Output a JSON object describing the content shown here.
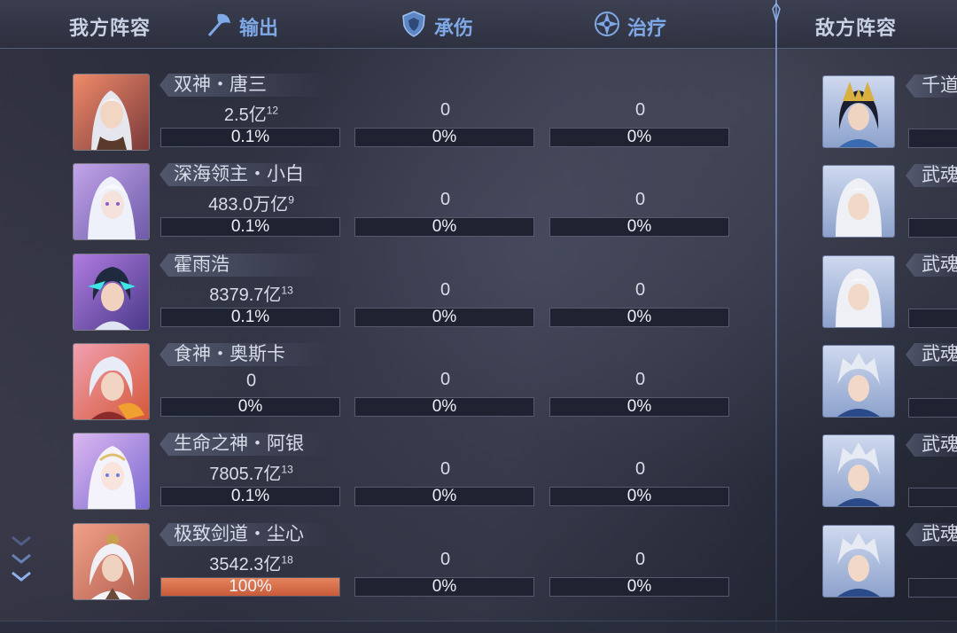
{
  "header": {
    "our_team": "我方阵容",
    "enemy_team": "敌方阵容",
    "tabs": [
      {
        "label": "输出",
        "icon": "axe-icon"
      },
      {
        "label": "承伤",
        "icon": "shield-icon"
      },
      {
        "label": "治疗",
        "icon": "heal-cross-icon"
      }
    ]
  },
  "colors": {
    "accent": "#7ea9e6",
    "output_bar_full": "#d86a46",
    "bar_bg": "#1f2230"
  },
  "our_rows": [
    {
      "name": "双神・唐三",
      "output": "2.5亿",
      "output_exp": "12",
      "output_pct": "0.1%",
      "output_fill": 0.001,
      "damage_taken": "0",
      "taken_pct": "0%",
      "healing": "0",
      "heal_pct": "0%"
    },
    {
      "name": "深海领主・小白",
      "output": "483.0万亿",
      "output_exp": "9",
      "output_pct": "0.1%",
      "output_fill": 0.001,
      "damage_taken": "0",
      "taken_pct": "0%",
      "healing": "0",
      "heal_pct": "0%"
    },
    {
      "name": "霍雨浩",
      "output": "8379.7亿",
      "output_exp": "13",
      "output_pct": "0.1%",
      "output_fill": 0.001,
      "damage_taken": "0",
      "taken_pct": "0%",
      "healing": "0",
      "heal_pct": "0%"
    },
    {
      "name": "食神・奥斯卡",
      "output": "0",
      "output_exp": "",
      "output_pct": "0%",
      "output_fill": 0,
      "damage_taken": "0",
      "taken_pct": "0%",
      "healing": "0",
      "heal_pct": "0%"
    },
    {
      "name": "生命之神・阿银",
      "output": "7805.7亿",
      "output_exp": "13",
      "output_pct": "0.1%",
      "output_fill": 0.001,
      "damage_taken": "0",
      "taken_pct": "0%",
      "healing": "0",
      "heal_pct": "0%"
    },
    {
      "name": "极致剑道・尘心",
      "output": "3542.3亿",
      "output_exp": "18",
      "output_pct": "100%",
      "output_fill": 1.0,
      "damage_taken": "0",
      "taken_pct": "0%",
      "healing": "0",
      "heal_pct": "0%"
    }
  ],
  "enemy_rows": [
    {
      "name": "千道"
    },
    {
      "name": "武魂"
    },
    {
      "name": "武魂"
    },
    {
      "name": "武魂"
    },
    {
      "name": "武魂"
    },
    {
      "name": "武魂"
    }
  ]
}
